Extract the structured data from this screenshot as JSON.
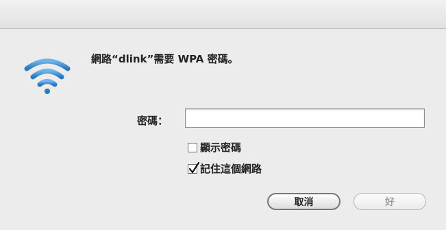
{
  "dialog": {
    "message": "網路“dlink”需要 WPA 密碼。",
    "password_label": "密碼：",
    "password_value": "",
    "show_password_label": "顯示密碼",
    "show_password_checked": false,
    "remember_network_label": "記住這個網路",
    "remember_network_checked": true,
    "cancel_label": "取消",
    "ok_label": "好",
    "wifi_icon_color": "#3c8fd0"
  }
}
